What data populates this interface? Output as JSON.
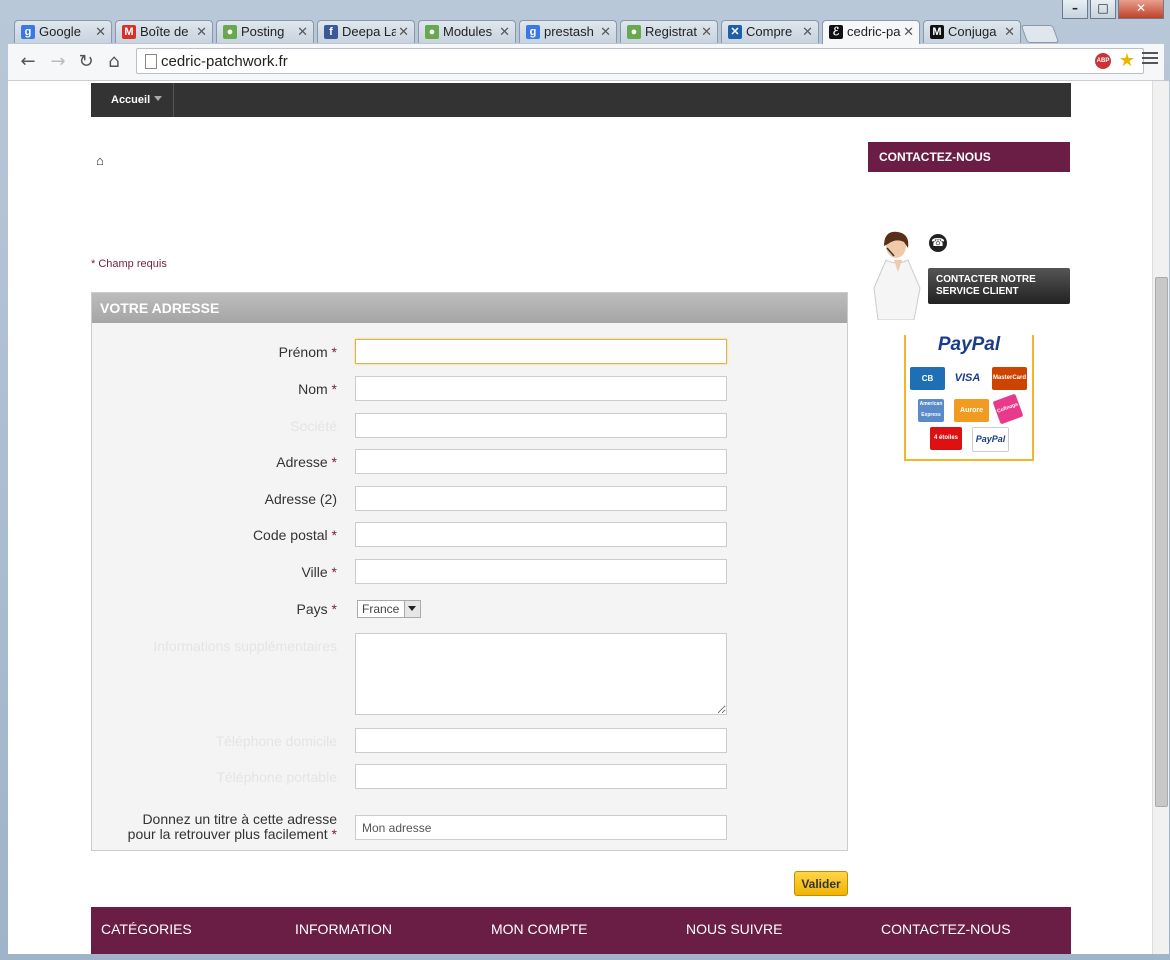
{
  "browser": {
    "tabs": [
      {
        "label": "Google",
        "icon": "google-icon",
        "color": "#3b78e7",
        "glyph": "g"
      },
      {
        "label": "Boîte de",
        "icon": "gmail-icon",
        "color": "#d93025",
        "glyph": "M"
      },
      {
        "label": "Posting",
        "icon": "prestashop-icon",
        "color": "#6aa84f",
        "glyph": "●"
      },
      {
        "label": "Deepa La",
        "icon": "facebook-icon",
        "color": "#3b5998",
        "glyph": "f"
      },
      {
        "label": "Modules",
        "icon": "prestashop-icon",
        "color": "#6aa84f",
        "glyph": "●"
      },
      {
        "label": "prestash",
        "icon": "google-icon",
        "color": "#3b78e7",
        "glyph": "g"
      },
      {
        "label": "Registrat",
        "icon": "prestashop-icon",
        "color": "#6aa84f",
        "glyph": "●"
      },
      {
        "label": "Compre",
        "icon": "tools-icon",
        "color": "#1f5fa8",
        "glyph": "✕"
      },
      {
        "label": "cedric-pa",
        "icon": "site-icon",
        "color": "#111111",
        "glyph": "ℰ"
      },
      {
        "label": "Conjuga",
        "icon": "lemonde-icon",
        "color": "#111111",
        "glyph": "M"
      }
    ],
    "url": "cedric-patchwork.fr"
  },
  "nav": {
    "home_menu": "Accueil"
  },
  "form": {
    "required_note": "* Champ requis",
    "section_title": "VOTRE ADRESSE",
    "fields": {
      "prenom": "Prénom",
      "nom": "Nom",
      "societe": "Société",
      "adresse": "Adresse",
      "adresse2": "Adresse (2)",
      "code_postal": "Code postal",
      "ville": "Ville",
      "pays": "Pays",
      "pays_value": "France",
      "infos": "Informations supplémentaires",
      "tel_domicile": "Téléphone domicile",
      "tel_portable": "Téléphone portable",
      "alias_line1": "Donnez un titre à cette adresse",
      "alias_line2": "pour la retrouver plus facilement",
      "alias_value": "Mon adresse"
    },
    "required_mark": "*",
    "submit": "Valider"
  },
  "sidebar": {
    "contact_title": "CONTACTEZ-NOUS",
    "service_line1": "CONTACTER NOTRE",
    "service_line2": "SERVICE CLIENT",
    "paypal_title": "PayPal",
    "cards": [
      "CB",
      "VISA",
      "MasterCard",
      "American Express",
      "Aurore",
      "Cofinoga",
      "4 étoiles",
      "PayPal"
    ]
  },
  "footer": {
    "categories": "CATÉGORIES",
    "information": "INFORMATION",
    "account": "MON COMPTE",
    "follow": "NOUS SUIVRE",
    "contact": "CONTACTEZ-NOUS"
  },
  "colors": {
    "brand": "#6a1d45",
    "accent": "#f3b52a",
    "nav": "#333333"
  }
}
